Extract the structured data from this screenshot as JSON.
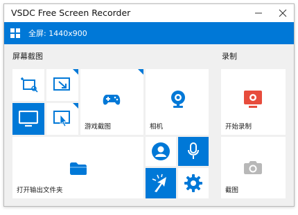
{
  "window": {
    "title": "VSDC Free Screen Recorder"
  },
  "bar": {
    "text": "全屏: 1440x900"
  },
  "sections": {
    "screenshot": "屏幕截图",
    "record": "录制"
  },
  "tiles": {
    "game_capture": "游戏截图",
    "camera": "相机",
    "open_output_folder": "打开输出文件夹",
    "start_recording": "开始录制",
    "screenshot": "截图"
  },
  "colors": {
    "accent": "#0078d7",
    "record_red": "#e74c3c",
    "tile_bg": "#ffffff",
    "window_bg": "#f0f0f0"
  }
}
